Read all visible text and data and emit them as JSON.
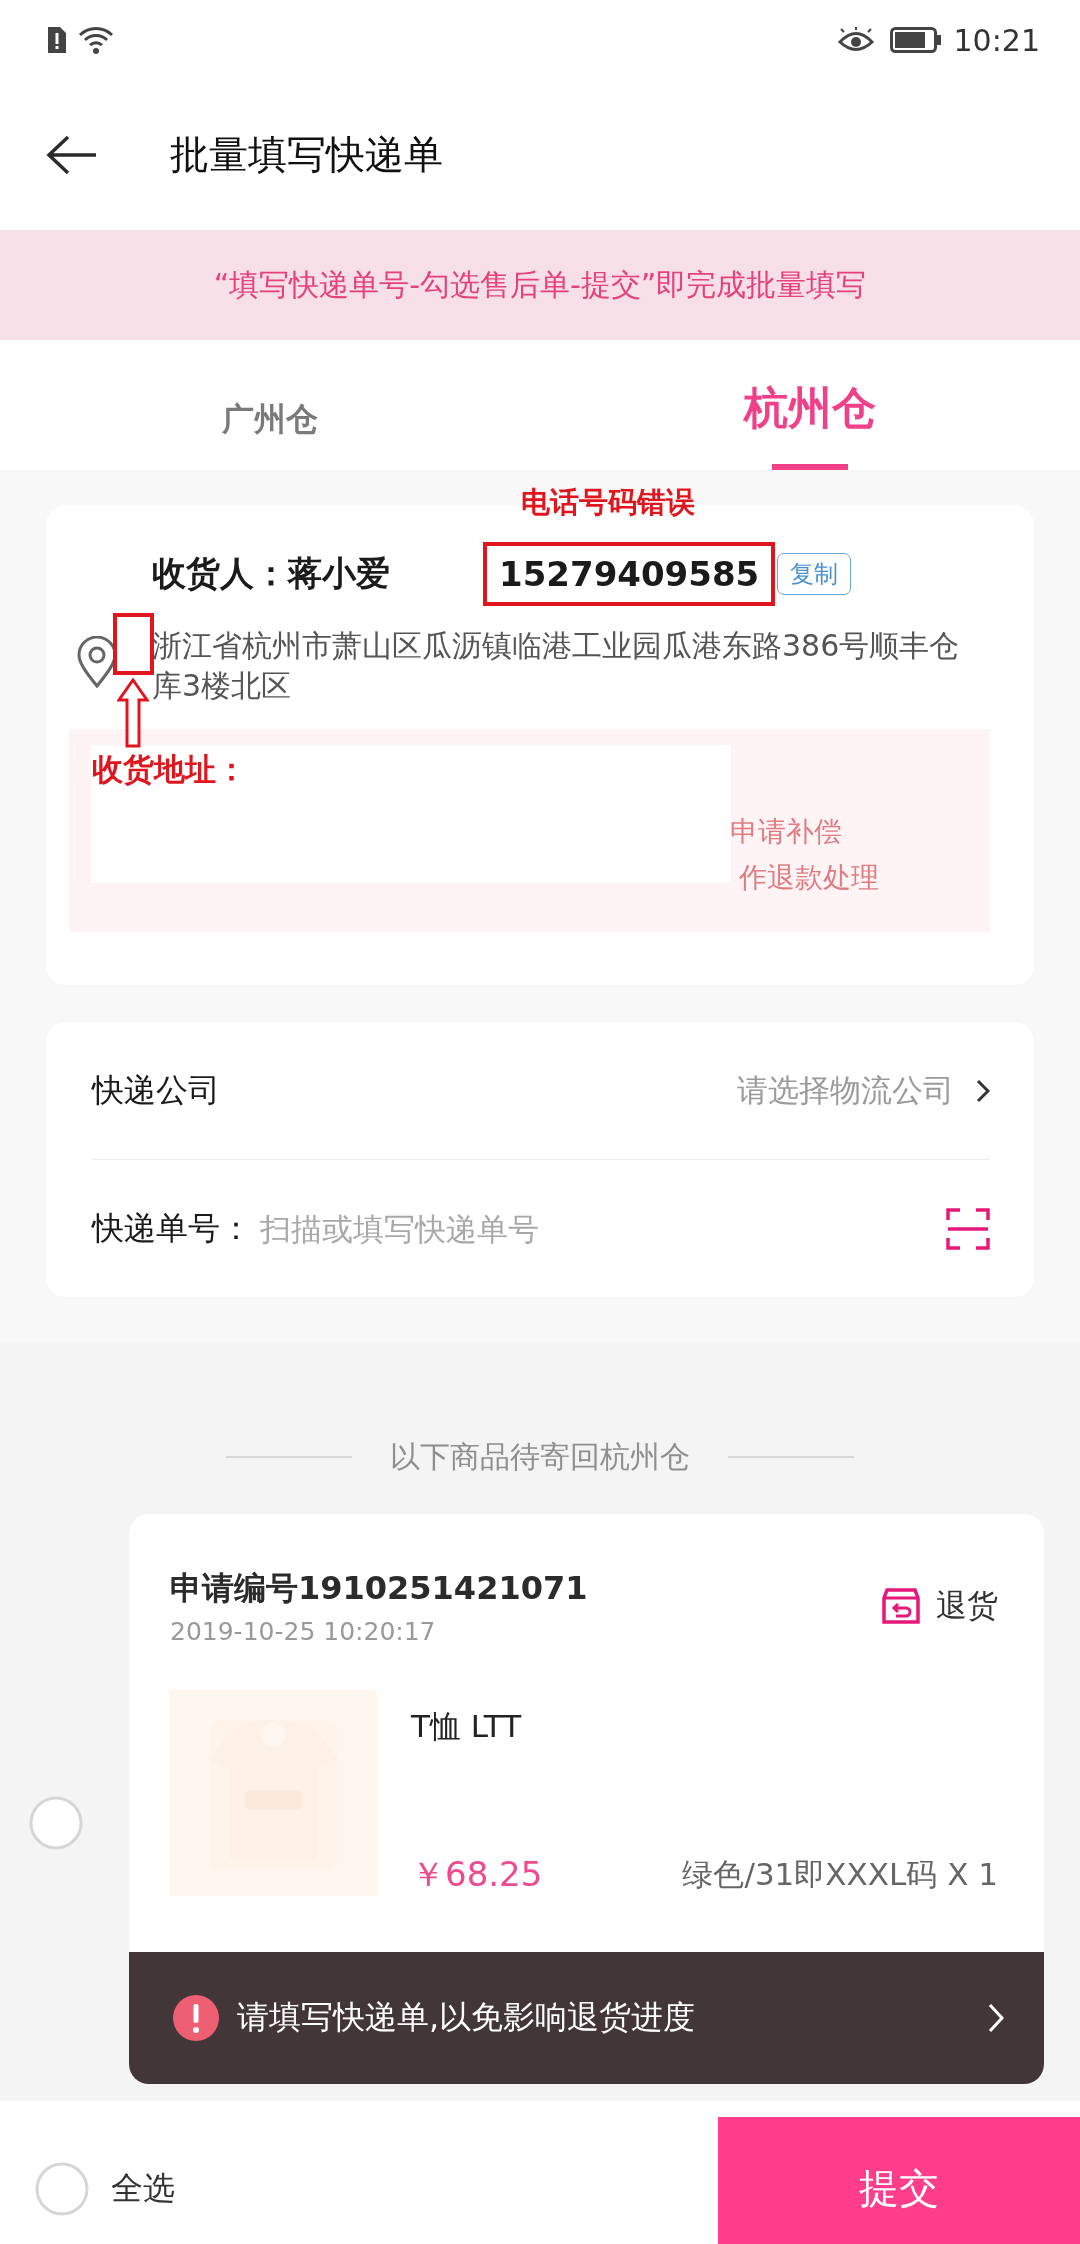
{
  "status_bar": {
    "time": "10:21"
  },
  "header": {
    "title": "批量填写快递单"
  },
  "banner": {
    "text": "“填写快递单号-勾选售后单-提交”即完成批量填写"
  },
  "tabs": [
    {
      "label": "广州仓",
      "selected": false
    },
    {
      "label": "杭州仓",
      "selected": true
    }
  ],
  "address_card": {
    "receiver": "收货人：蒋小爱",
    "phone": "15279409585",
    "copy_button": "复制",
    "address": "浙江省杭州市萧山区瓜沥镇临港工业园瓜港东路386号顺丰仓库3楼北区",
    "notice_lines": [
      "申请补偿",
      "作退款处理"
    ]
  },
  "annotations": {
    "phone_note": "电话号码错误",
    "address_note": "收货地址："
  },
  "courier": {
    "company_label": "快递公司",
    "company_placeholder": "请选择物流公司",
    "number_label": "快递单号：",
    "number_placeholder": "扫描或填写快递单号"
  },
  "divider_text": "以下商品待寄回杭州仓",
  "orders": [
    {
      "selected": false,
      "request_no": "申请编号1910251421071",
      "time": "2019-10-25 10:20:17",
      "type": "退货",
      "product_name": "T恤 LTT",
      "price": "￥68.25",
      "spec": "绿色/31即XXXL码 X 1"
    }
  ],
  "toast": {
    "text": "请填写快递单,以免影响退货进度"
  },
  "bottom_bar": {
    "select_all": "全选",
    "select_all_checked": false,
    "submit": "提交"
  }
}
